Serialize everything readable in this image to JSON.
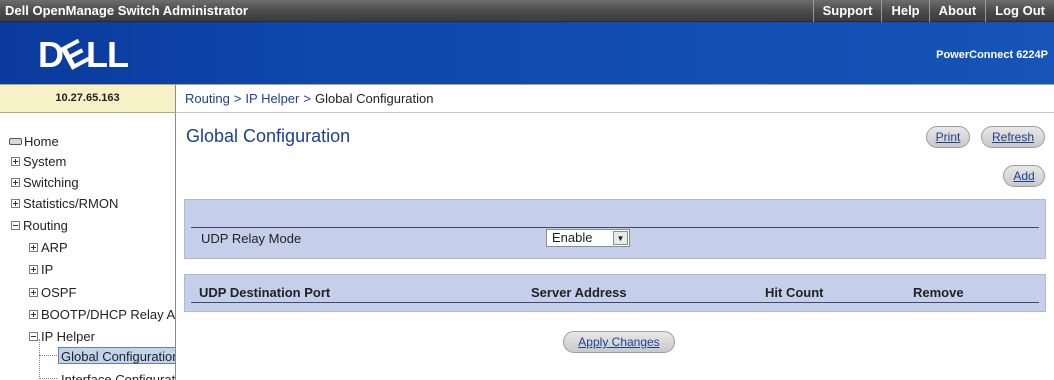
{
  "app": {
    "title": "Dell OpenManage Switch Administrator",
    "top_links": [
      "Support",
      "Help",
      "About",
      "Log Out"
    ],
    "logo_text": "DELL",
    "product": "PowerConnect 6224P",
    "ip": "10.27.65.163"
  },
  "breadcrumb": {
    "items": [
      "Routing",
      "IP Helper",
      "Global Configuration"
    ],
    "separator": ">"
  },
  "sidebar": {
    "home": "Home",
    "items": [
      "System",
      "Switching",
      "Statistics/RMON",
      "Routing"
    ],
    "routing_children": [
      "ARP",
      "IP",
      "OSPF",
      "BOOTP/DHCP Relay A",
      "IP Helper"
    ],
    "ip_helper_children": [
      "Global Configuration",
      "Interface Configurati"
    ]
  },
  "main": {
    "title": "Global Configuration",
    "print_label": "Print",
    "refresh_label": "Refresh",
    "add_label": "Add",
    "udp_relay_label": "UDP Relay Mode",
    "udp_relay_value": "Enable",
    "columns": [
      "UDP Destination Port",
      "Server Address",
      "Hit Count",
      "Remove"
    ],
    "apply_label": "Apply Changes"
  },
  "colors": {
    "banner": "#0f47ac",
    "accent_text": "#1e3f8f",
    "section_bg": "#c5cfe9",
    "ip_bg": "#f7f1c8"
  }
}
